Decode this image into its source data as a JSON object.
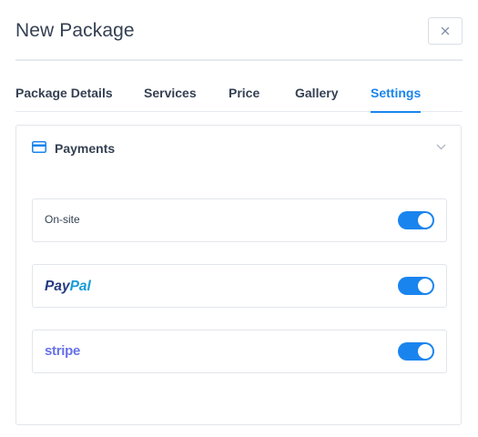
{
  "dialog": {
    "title": "New Package",
    "close_icon": "close-icon"
  },
  "tabs": [
    {
      "label": "Package Details",
      "active": false
    },
    {
      "label": "Services",
      "active": false
    },
    {
      "label": "Price",
      "active": false
    },
    {
      "label": "Gallery",
      "active": false
    },
    {
      "label": "Settings",
      "active": true
    }
  ],
  "payments": {
    "title": "Payments",
    "icon": "credit-card-icon",
    "collapse_icon": "chevron-down-icon",
    "methods": [
      {
        "label": "On-site",
        "type": "text",
        "enabled": true
      },
      {
        "label": "PayPal",
        "type": "logo",
        "logo": "paypal-logo",
        "enabled": true
      },
      {
        "label": "stripe",
        "type": "logo",
        "logo": "stripe-logo",
        "enabled": true
      }
    ]
  },
  "colors": {
    "accent": "#1a84ee",
    "text": "#354052",
    "border": "#e2e5ea",
    "paypal_dark": "#253b80",
    "paypal_light": "#179bd7",
    "stripe": "#6772e5"
  }
}
